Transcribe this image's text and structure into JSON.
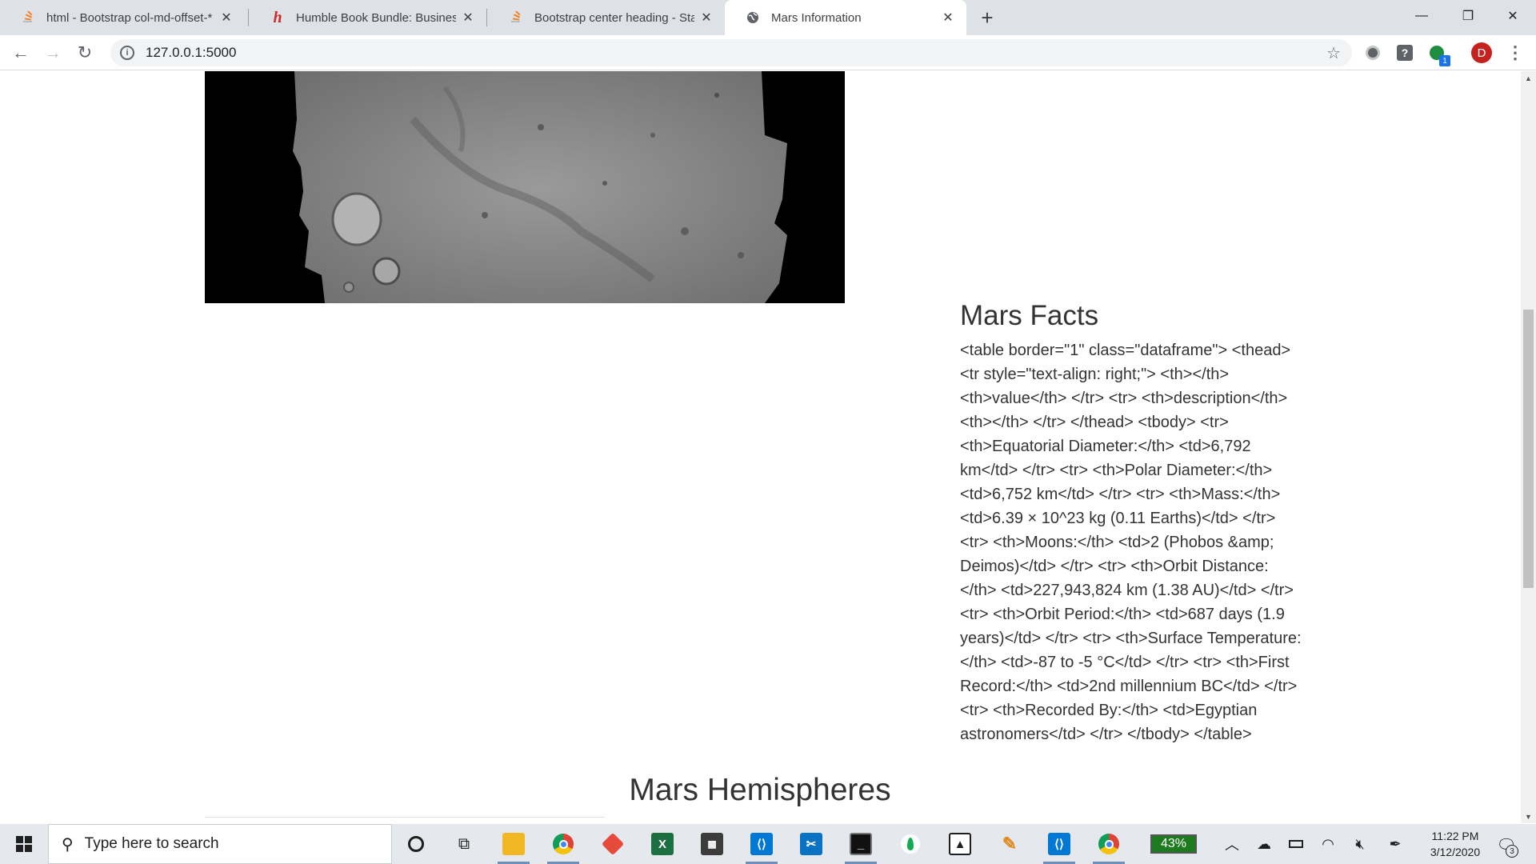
{
  "browser": {
    "tabs": [
      {
        "title": "html - Bootstrap col-md-offset-*",
        "favicon": "stackoverflow-icon",
        "active": false
      },
      {
        "title": "Humble Book Bundle: Business In",
        "favicon": "humble-bundle-icon",
        "active": false
      },
      {
        "title": "Bootstrap center heading - Stack",
        "favicon": "stackoverflow-icon",
        "active": false
      },
      {
        "title": "Mars Information",
        "favicon": "globe-icon",
        "active": true
      }
    ],
    "url": "127.0.0.1:5000",
    "profile_initial": "D",
    "extension_badge": "1"
  },
  "page": {
    "facts_title": "Mars Facts",
    "facts_raw_html": "<table border=\"1\" class=\"dataframe\"> <thead> <tr style=\"text-align: right;\"> <th></th> <th>value</th> </tr> <tr> <th>description</th> <th></th> </tr> </thead> <tbody> <tr> <th>Equatorial Diameter:</th> <td>6,792 km</td> </tr> <tr> <th>Polar Diameter:</th> <td>6,752 km</td> </tr> <tr> <th>Mass:</th> <td>6.39 × 10^23 kg (0.11 Earths)</td> </tr> <tr> <th>Moons:</th> <td>2 (Phobos &amp; Deimos)</td> </tr> <tr> <th>Orbit Distance:</th> <td>227,943,824 km (1.38 AU)</td> </tr> <tr> <th>Orbit Period:</th> <td>687 days (1.9 years)</td> </tr> <tr> <th>Surface Temperature:</th> <td>-87 to -5 °C</td> </tr> <tr> <th>First Record:</th> <td>2nd millennium BC</td> </tr> <tr> <th>Recorded By:</th> <td>Egyptian astronomers</td> </tr> </tbody> </table>",
    "hemispheres_title": "Mars Hemispheres"
  },
  "taskbar": {
    "search_placeholder": "Type here to search",
    "battery_percent": "43%",
    "time": "11:22 PM",
    "date": "3/12/2020",
    "notification_count": "3",
    "pinned_apps": [
      "cortana-icon",
      "task-view-icon",
      "file-explorer-icon",
      "chrome-icon",
      "git-icon",
      "excel-icon",
      "calculator-icon",
      "vscode-icon",
      "snipping-tool-icon",
      "terminal-icon",
      "mongodb-icon",
      "photos-icon",
      "paint-icon",
      "vscode-icon",
      "chrome-icon"
    ]
  },
  "colors": {
    "tab_strip": "#dee1e6",
    "text": "#333333",
    "taskbar": "#e5e9ee",
    "battery": "#1e7a1e",
    "avatar": "#c5221f"
  }
}
